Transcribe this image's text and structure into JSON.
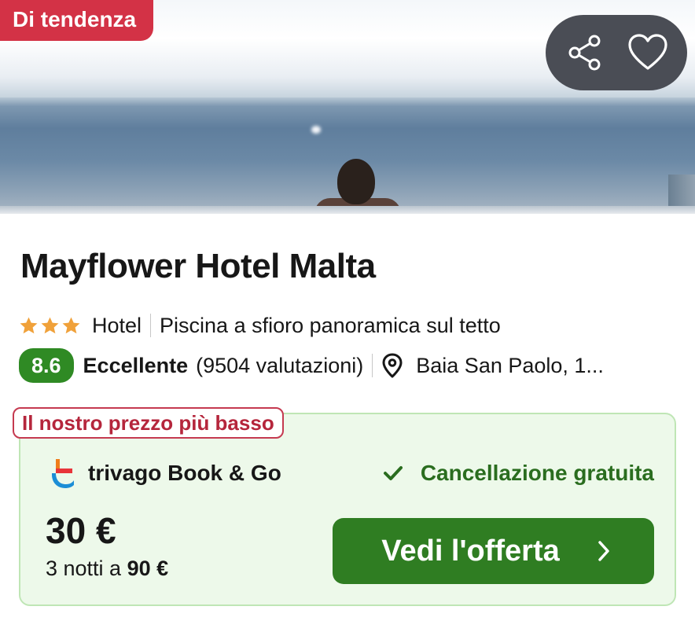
{
  "hero": {
    "badge": "Di tendenza",
    "share_icon": "share-icon",
    "favorite_icon": "heart-icon"
  },
  "hotel": {
    "name": "Mayflower Hotel Malta",
    "stars": 3,
    "star_color": "#F0A13A",
    "type": "Hotel",
    "highlight": "Piscina a sfioro panoramica sul tetto",
    "score": "8.6",
    "rating_word": "Eccellente",
    "reviews": "(9504 valutazioni)",
    "location": "Baia San Paolo, 1..."
  },
  "deal": {
    "badge": "Il nostro prezzo più basso",
    "provider": "trivago Book & Go",
    "cancellation": "Cancellazione gratuita",
    "price": "30 €",
    "nights_prefix": "3 notti a",
    "total": "90 €",
    "cta": "Vedi l'offerta"
  },
  "colors": {
    "trend_badge": "#D33246",
    "score_bg": "#2F8A24",
    "deal_bg": "#EDF9EA",
    "cta_bg": "#2F7D22",
    "lowest_price_accent": "#B5263C"
  }
}
